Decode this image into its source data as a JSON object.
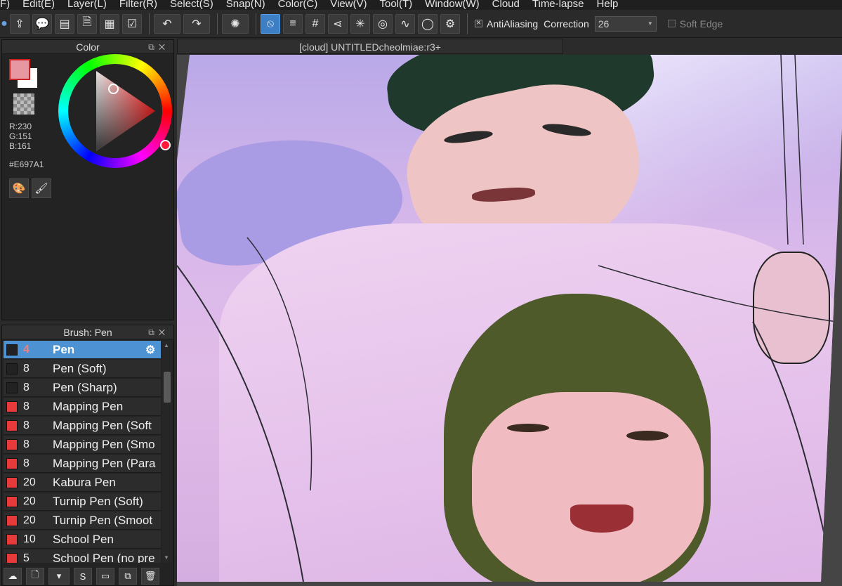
{
  "menu": [
    "F)",
    "Edit(E)",
    "Layer(L)",
    "Filter(R)",
    "Select(S)",
    "Snap(N)",
    "Color(C)",
    "View(V)",
    "Tool(T)",
    "Window(W)",
    "Cloud",
    "Time-lapse",
    "Help"
  ],
  "toolbar": {
    "antialiasing_label": "AntiAliasing",
    "correction_label": "Correction",
    "correction_value": "26",
    "soft_edge_label": "Soft Edge"
  },
  "color_panel": {
    "title": "Color",
    "r": "R:230",
    "g": "G:151",
    "b": "B:161",
    "hex": "#E697A1",
    "fg_color": "#e697a1"
  },
  "brush_panel": {
    "title": "Brush: Pen",
    "items": [
      {
        "size": "4",
        "name": "Pen",
        "swatch": "#222222",
        "selected": true
      },
      {
        "size": "8",
        "name": "Pen (Soft)",
        "swatch": "#222222"
      },
      {
        "size": "8",
        "name": "Pen (Sharp)",
        "swatch": "#222222"
      },
      {
        "size": "8",
        "name": "Mapping Pen",
        "swatch": "#e83a3a"
      },
      {
        "size": "8",
        "name": "Mapping Pen (Soft",
        "swatch": "#e83a3a"
      },
      {
        "size": "8",
        "name": "Mapping Pen (Smo",
        "swatch": "#e83a3a"
      },
      {
        "size": "8",
        "name": "Mapping Pen (Para",
        "swatch": "#e83a3a"
      },
      {
        "size": "20",
        "name": "Kabura Pen",
        "swatch": "#e83a3a"
      },
      {
        "size": "20",
        "name": "Turnip Pen (Soft)",
        "swatch": "#e83a3a"
      },
      {
        "size": "20",
        "name": "Turnip Pen (Smoot",
        "swatch": "#e83a3a"
      },
      {
        "size": "10",
        "name": "School Pen",
        "swatch": "#e83a3a"
      },
      {
        "size": "5",
        "name": "School Pen (no pre",
        "swatch": "#e83a3a"
      }
    ]
  },
  "canvas": {
    "tab_title": "[cloud] UNTITLEDcheolmiae:r3+"
  }
}
